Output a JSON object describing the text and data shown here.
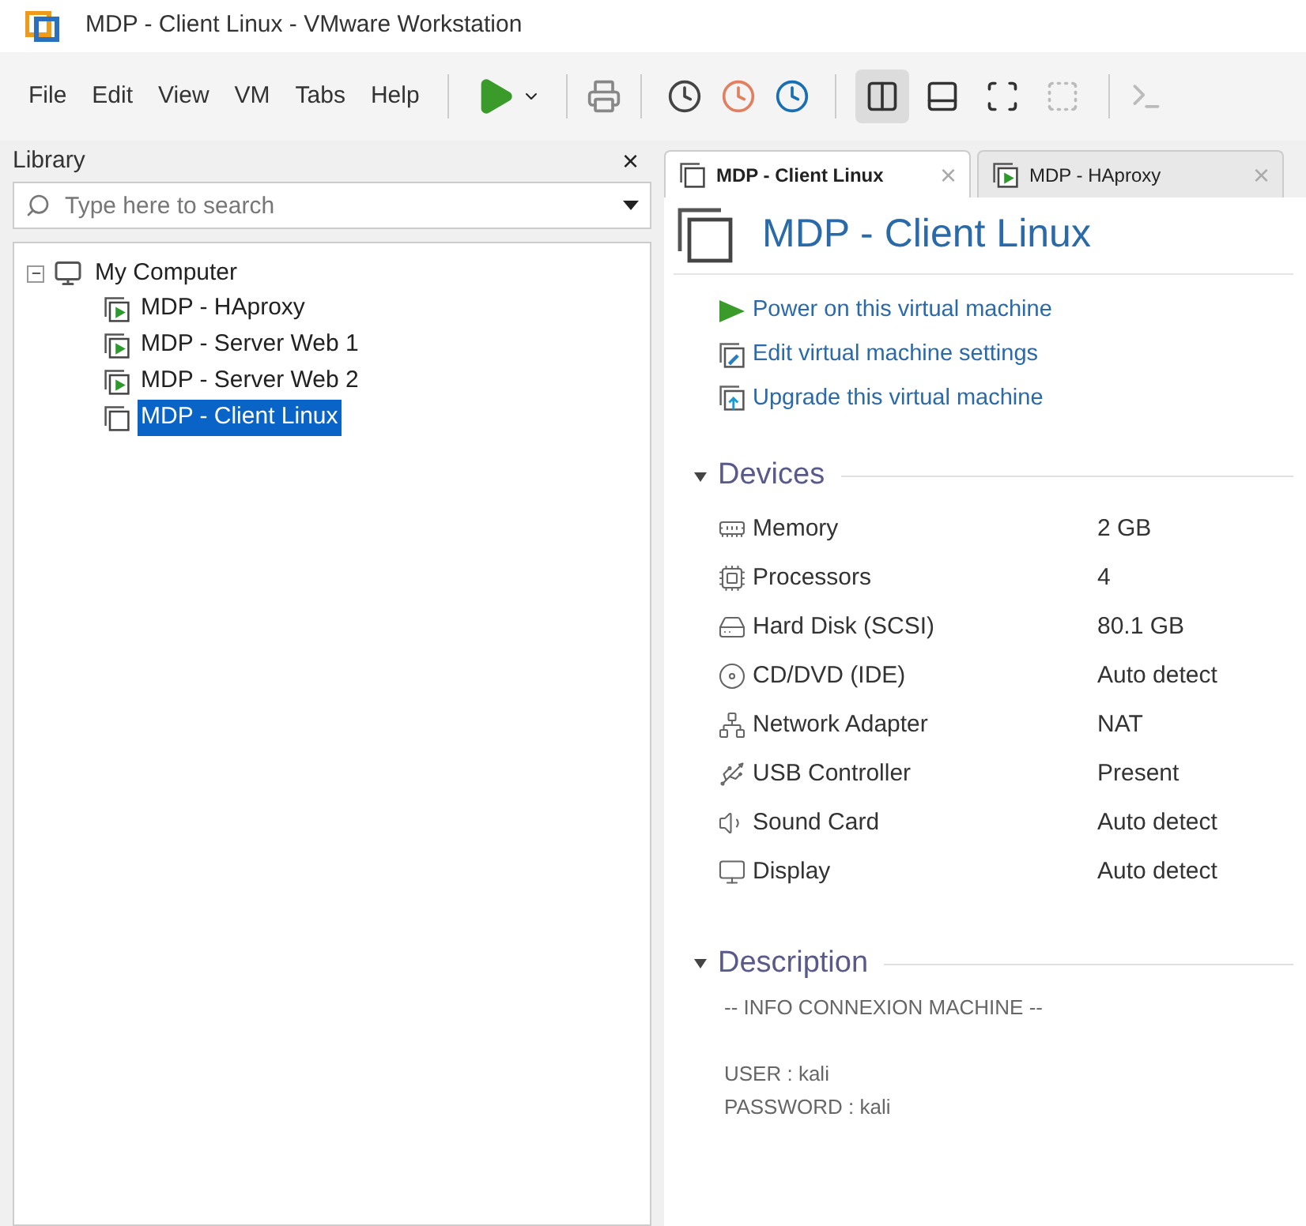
{
  "window": {
    "title": "MDP - Client Linux - VMware Workstation"
  },
  "menu": [
    "File",
    "Edit",
    "View",
    "VM",
    "Tabs",
    "Help"
  ],
  "library": {
    "title": "Library",
    "close": "×",
    "search": {
      "placeholder": "Type here to search"
    },
    "tree": [
      {
        "label": "My Computer",
        "expanded": true,
        "selected": false,
        "children": [
          {
            "label": "MDP - HAproxy",
            "running": true,
            "selected": false
          },
          {
            "label": "MDP - Server Web 1",
            "running": true,
            "selected": false
          },
          {
            "label": "MDP - Server Web 2",
            "running": true,
            "selected": false
          },
          {
            "label": "MDP - Client Linux",
            "running": false,
            "selected": true
          }
        ]
      }
    ]
  },
  "tabs": [
    {
      "label": "MDP - Client Linux",
      "running": false,
      "selected": true,
      "close": "×"
    },
    {
      "label": "MDP - HAproxy",
      "running": true,
      "selected": false,
      "close": "×"
    }
  ],
  "vm": {
    "title": "MDP - Client Linux",
    "actions": [
      {
        "kind": "power",
        "label": "Power on this virtual machine"
      },
      {
        "kind": "edit",
        "label": "Edit virtual machine settings"
      },
      {
        "kind": "upgrade",
        "label": "Upgrade this virtual machine"
      }
    ],
    "devices": {
      "title": "Devices",
      "expanded": true,
      "rows": [
        {
          "kind": "memory",
          "name": "Memory",
          "value": "2 GB"
        },
        {
          "kind": "cpu",
          "name": "Processors",
          "value": "4"
        },
        {
          "kind": "disk",
          "name": "Hard Disk (SCSI)",
          "value": "80.1 GB"
        },
        {
          "kind": "cd",
          "name": "CD/DVD (IDE)",
          "value": "Auto detect"
        },
        {
          "kind": "network",
          "name": "Network Adapter",
          "value": "NAT"
        },
        {
          "kind": "usb",
          "name": "USB Controller",
          "value": "Present"
        },
        {
          "kind": "sound",
          "name": "Sound Card",
          "value": "Auto detect"
        },
        {
          "kind": "display",
          "name": "Display",
          "value": "Auto detect"
        }
      ]
    },
    "description": {
      "title": "Description",
      "expanded": true,
      "paragraphs": [
        [
          "-- INFO CONNEXION MACHINE --"
        ],
        [
          "USER : kali",
          "PASSWORD : kali"
        ]
      ]
    }
  }
}
